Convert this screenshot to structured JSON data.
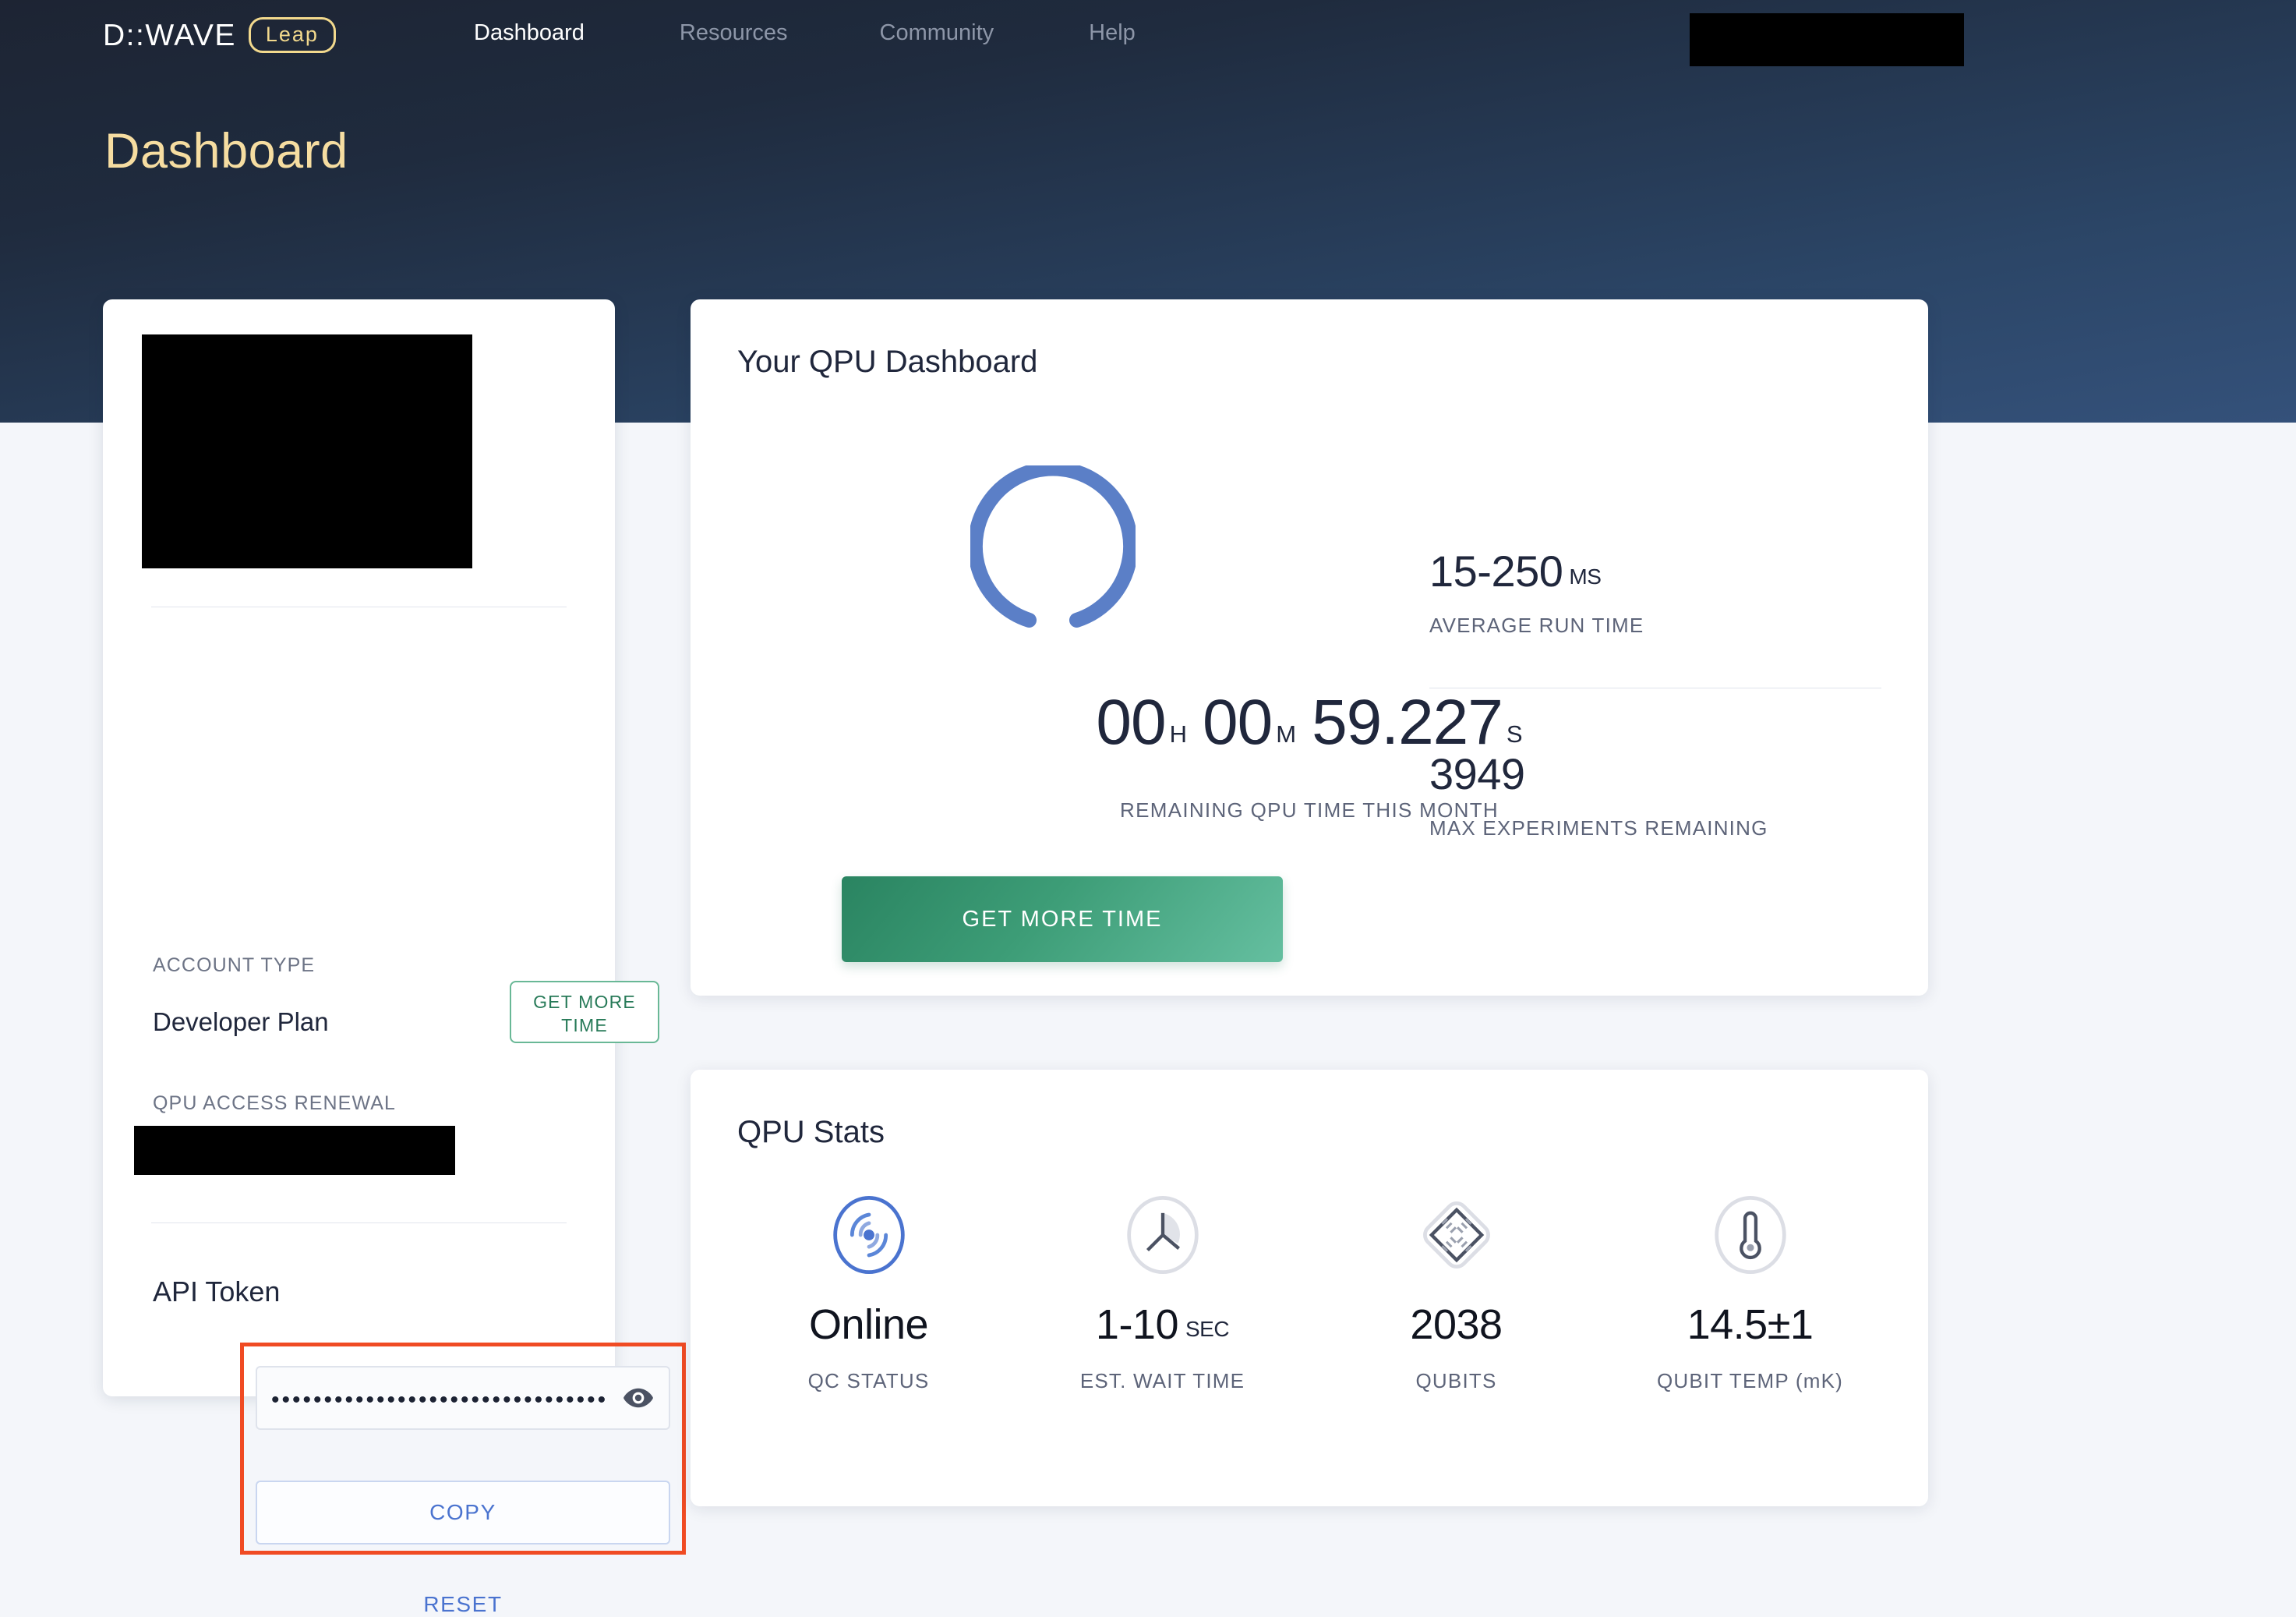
{
  "brand": {
    "logo_word": "D::WAVE",
    "logo_badge": "Leap"
  },
  "nav": {
    "items": [
      {
        "label": "Dashboard",
        "active": true
      },
      {
        "label": "Resources",
        "active": false
      },
      {
        "label": "Community",
        "active": false
      },
      {
        "label": "Help",
        "active": false
      }
    ]
  },
  "page": {
    "title": "Dashboard"
  },
  "account_card": {
    "account_type_label": "ACCOUNT TYPE",
    "account_type_value": "Developer Plan",
    "get_more_time_label": "GET MORE TIME",
    "renewal_label": "QPU ACCESS RENEWAL",
    "api_token_title": "API Token",
    "api_token_value": "••••••••••••••••••••••••••••••••",
    "api_token_placeholder": "API Token",
    "copy_label": "COPY",
    "reset_label": "RESET",
    "highlight_color": "#f04b23"
  },
  "qpu_dashboard": {
    "title": "Your QPU Dashboard",
    "timer": {
      "hours": "00",
      "hours_unit": "H",
      "minutes": "00",
      "minutes_unit": "M",
      "seconds": "59.227",
      "seconds_unit": "S"
    },
    "timer_caption": "REMAINING QPU TIME THIS MONTH",
    "get_more_time_label": "GET MORE TIME",
    "ring_color": "#5b7fc7",
    "stats": [
      {
        "value": "15-250",
        "suffix": "MS",
        "caption": "AVERAGE RUN TIME"
      },
      {
        "value": "3949",
        "suffix": "",
        "caption": "MAX EXPERIMENTS REMAINING"
      }
    ]
  },
  "qpu_stats": {
    "title": "QPU Stats",
    "items": [
      {
        "icon": "signal-icon",
        "value": "Online",
        "unit": "",
        "label": "QC STATUS"
      },
      {
        "icon": "clock-icon",
        "value": "1-10",
        "unit": "SEC",
        "label": "EST. WAIT TIME"
      },
      {
        "icon": "chip-icon",
        "value": "2038",
        "unit": "",
        "label": "QUBITS"
      },
      {
        "icon": "thermometer-icon",
        "value": "14.5±1",
        "unit": "",
        "label": "QUBIT TEMP (mK)"
      }
    ]
  }
}
